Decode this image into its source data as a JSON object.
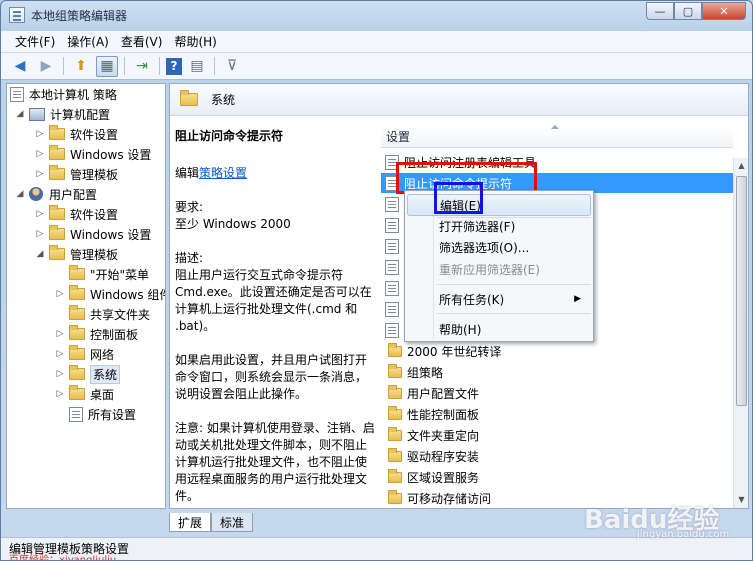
{
  "window": {
    "title": "本地组策略编辑器",
    "buttons": {
      "minimize": "—",
      "maximize": "▢",
      "close": "✕"
    }
  },
  "menubar": [
    "文件(F)",
    "操作(A)",
    "查看(V)",
    "帮助(H)"
  ],
  "toolbar": {
    "back": "◀",
    "forward": "▶",
    "up": "⬆",
    "show_hide_tree": "▦",
    "export": "⇥",
    "help": "?",
    "properties": "▤",
    "filter": "⊽"
  },
  "tree": {
    "root": "本地计算机 策略",
    "computer_config": "计算机配置",
    "computer_children": [
      "软件设置",
      "Windows 设置",
      "管理模板"
    ],
    "user_config": "用户配置",
    "user_children": [
      "软件设置",
      "Windows 设置",
      "管理模板"
    ],
    "admin_templates_children": [
      "\"开始\"菜单",
      "Windows 组件",
      "共享文件夹",
      "控制面板",
      "网络",
      "系统",
      "桌面",
      "所有设置"
    ]
  },
  "right": {
    "path": "系统",
    "desc": {
      "title": "阻止访问命令提示符",
      "edit_prefix": "编辑",
      "edit_link": "策略设置",
      "req_label": "要求:",
      "req_value": "至少 Windows 2000",
      "desc_label": "描述:",
      "desc_text": "阻止用户运行交互式命令提示符 Cmd.exe。此设置还确定是否可以在计算机上运行批处理文件(.cmd 和 .bat)。",
      "para2": "如果启用此设置，并且用户试图打开命令窗口，则系统会显示一条消息，说明设置会阻止此操作。",
      "para3": "注意: 如果计算机使用登录、注销、启动或关机批处理文件脚本，则不阻止计算机运行批处理文件，也不阻止使用远程桌面服务的用户运行批处理文件。"
    },
    "list_header": "设置",
    "list_items": [
      {
        "label": "阻止访问注册表编辑工具",
        "kind": "policy"
      },
      {
        "label": "阻止访问命令提示符",
        "kind": "policy"
      },
      {
        "label": "",
        "kind": "policy"
      },
      {
        "label": "",
        "kind": "policy"
      },
      {
        "label": "",
        "kind": "policy"
      },
      {
        "label": "",
        "kind": "policy"
      },
      {
        "label": "",
        "kind": "policy"
      },
      {
        "label": "",
        "kind": "policy"
      },
      {
        "label": "",
        "kind": "policy"
      },
      {
        "label": "2000 年世纪转译",
        "kind": "folder"
      },
      {
        "label": "组策略",
        "kind": "folder"
      },
      {
        "label": "用户配置文件",
        "kind": "folder"
      },
      {
        "label": "性能控制面板",
        "kind": "folder"
      },
      {
        "label": "文件夹重定向",
        "kind": "folder"
      },
      {
        "label": "驱动程序安装",
        "kind": "folder"
      },
      {
        "label": "区域设置服务",
        "kind": "folder"
      },
      {
        "label": "可移动存储访问",
        "kind": "folder"
      }
    ]
  },
  "context_menu": [
    "编辑(E)",
    "打开筛选器(F)",
    "筛选器选项(O)...",
    "重新应用筛选器(E)",
    "所有任务(K)",
    "帮助(H)"
  ],
  "tabs": [
    "扩展",
    "标准"
  ],
  "status": {
    "text": "编辑管理模板策略设置",
    "author": "百度经验：xiyangliuliu"
  },
  "watermark": {
    "brand": "Baidu经验",
    "sub": "jingyan.baidu.com"
  }
}
